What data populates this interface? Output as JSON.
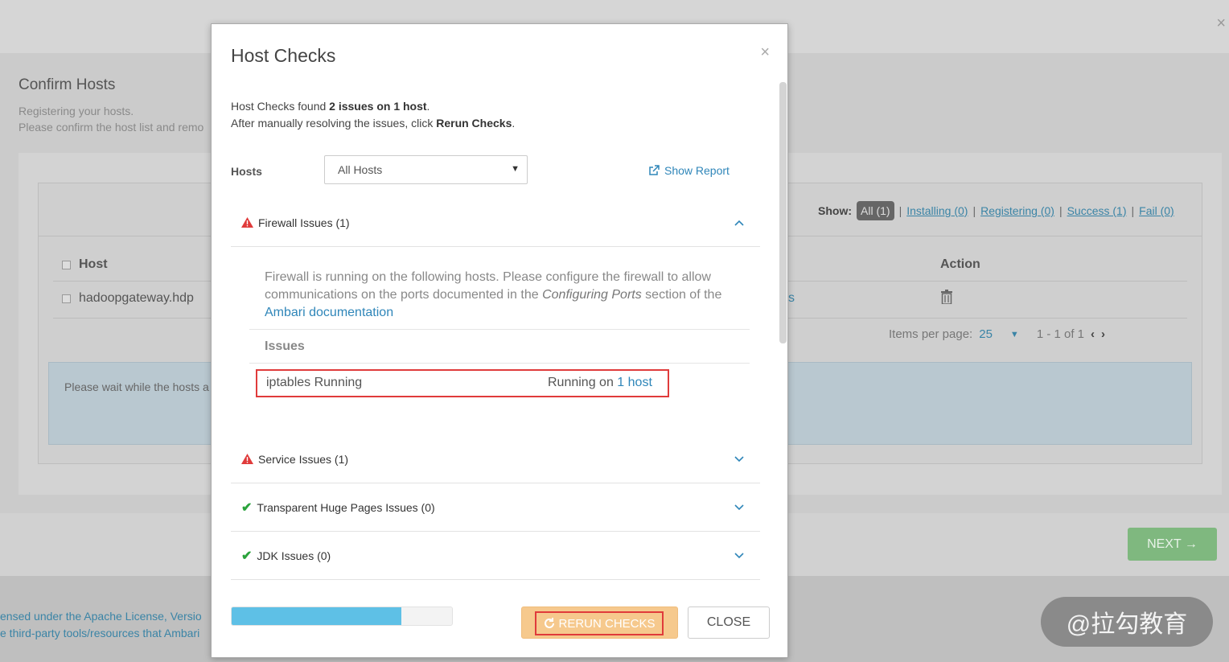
{
  "background": {
    "page_title": "Confirm Hosts",
    "subtitle_line1": "Registering your hosts.",
    "subtitle_line2": "Please confirm the host list and remo",
    "show_label": "Show:",
    "filters": [
      "All (1)",
      "Installing (0)",
      "Registering (0)",
      "Success (1)",
      "Fail (0)"
    ],
    "col_host": "Host",
    "col_action": "Action",
    "host_row": "hadoopgateway.hdp",
    "status_fragment": "s",
    "items_per_page_label": "Items per page:",
    "items_per_page_value": "25",
    "pagination": "1 - 1 of 1",
    "alert_text": "Please wait while the hosts a",
    "next_label": "NEXT →",
    "license_line1": "ensed under the Apache License, Versio",
    "license_line2": "e third-party tools/resources that Ambari",
    "watermark": "@拉勾教育"
  },
  "modal": {
    "title": "Host Checks",
    "close_glyph": "×",
    "summary_prefix": "Host Checks found ",
    "summary_bold": "2 issues on 1 host",
    "summary_suffix": ".",
    "instruction_prefix": "After manually resolving the issues, click ",
    "instruction_bold": "Rerun Checks",
    "instruction_suffix": ".",
    "hosts_label": "Hosts",
    "hosts_select_value": "All Hosts",
    "show_report": "Show Report",
    "sections": [
      {
        "title": "Firewall Issues (1)",
        "status": "warning",
        "expanded": true
      },
      {
        "title": "Service Issues (1)",
        "status": "warning",
        "expanded": false
      },
      {
        "title": "Transparent Huge Pages Issues (0)",
        "status": "ok",
        "expanded": false
      },
      {
        "title": "JDK Issues (0)",
        "status": "ok",
        "expanded": false
      }
    ],
    "firewall": {
      "desc_part1": "Firewall is running on the following hosts. Please configure the firewall to allow communications on the ports documented in the ",
      "desc_italic": "Configuring Ports",
      "desc_part2": " section of the ",
      "desc_link": "Ambari documentation",
      "issues_header": "Issues",
      "issue_name": "iptables Running",
      "issue_status_prefix": "Running on ",
      "issue_status_link": "1 host"
    },
    "progress_fraction": 0.77,
    "rerun_label": "RERUN CHECKS",
    "close_label": "CLOSE"
  },
  "colors": {
    "link": "#2f86b9",
    "warning": "#e03b3b",
    "ok": "#2aa33c",
    "progress": "#5ec0e6",
    "rerun": "#f6c98d"
  }
}
